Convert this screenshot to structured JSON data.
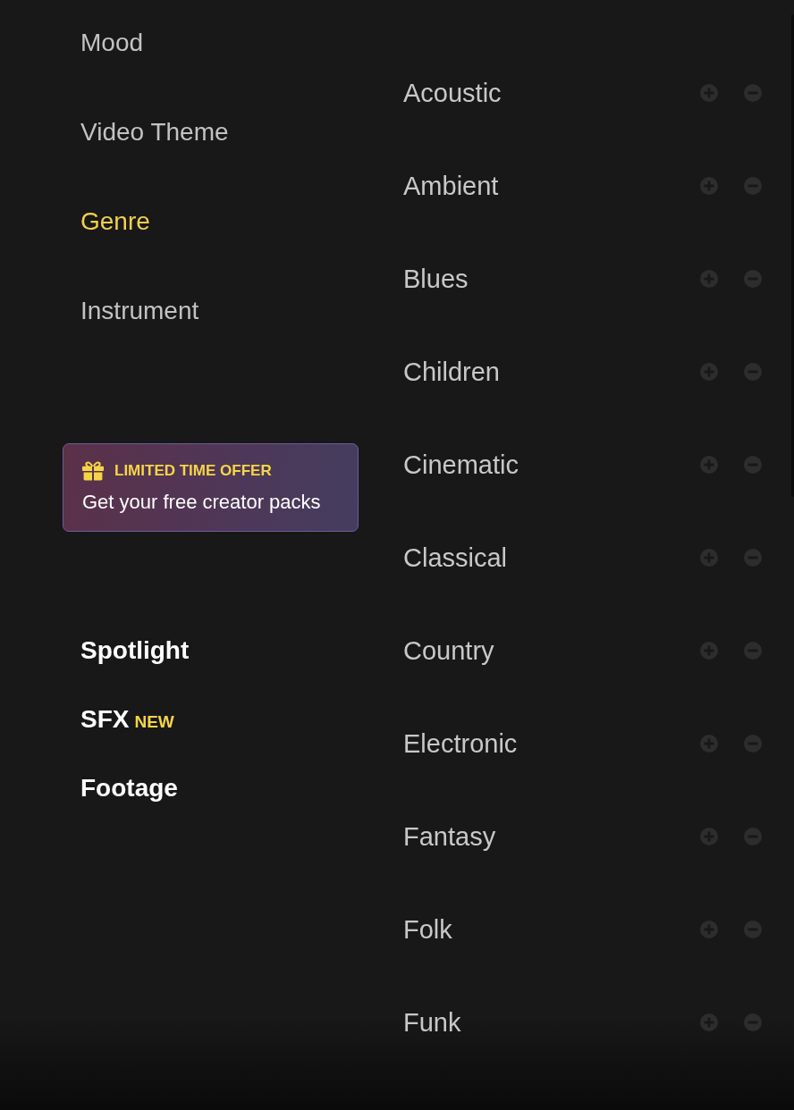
{
  "nav": {
    "items": [
      {
        "label": "Mood",
        "selected": false
      },
      {
        "label": "Video Theme",
        "selected": false
      },
      {
        "label": "Genre",
        "selected": true
      },
      {
        "label": "Instrument",
        "selected": false
      }
    ]
  },
  "promo": {
    "title": "LIMITED TIME OFFER",
    "text": "Get your free creator packs"
  },
  "links": [
    {
      "label": "Spotlight"
    },
    {
      "label": "SFX",
      "badge": "NEW"
    },
    {
      "label": "Footage"
    }
  ],
  "genres": [
    {
      "label": "Acoustic"
    },
    {
      "label": "Ambient"
    },
    {
      "label": "Blues"
    },
    {
      "label": "Children"
    },
    {
      "label": "Cinematic"
    },
    {
      "label": "Classical"
    },
    {
      "label": "Country"
    },
    {
      "label": "Electronic"
    },
    {
      "label": "Fantasy"
    },
    {
      "label": "Folk"
    },
    {
      "label": "Funk"
    }
  ]
}
